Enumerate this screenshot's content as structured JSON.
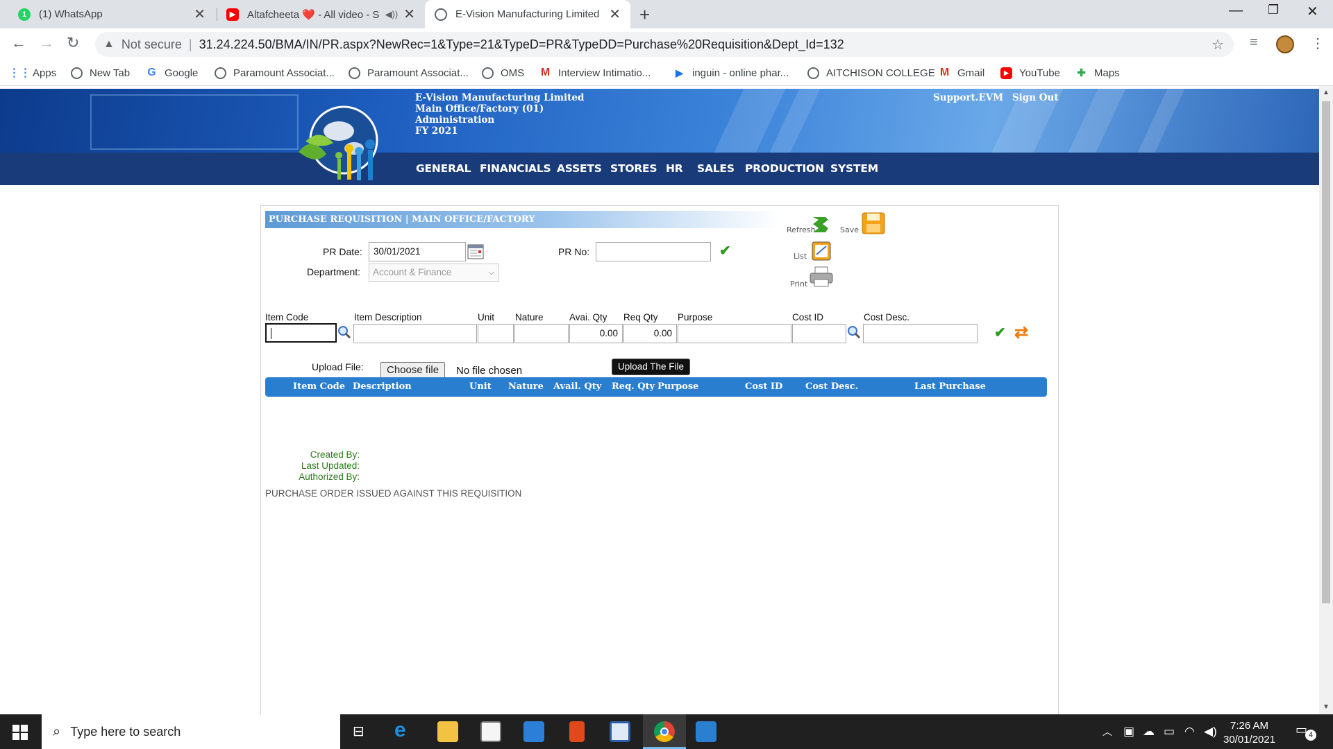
{
  "browser": {
    "tabs": [
      {
        "title": "(1) WhatsApp",
        "icon": "whatsapp-icon",
        "color": "#25d366",
        "badge": "1"
      },
      {
        "title": "Altafcheeta ❤️ - All video - S",
        "icon": "youtube-icon",
        "color": "#ff0000"
      },
      {
        "title": "E-Vision Manufacturing Limited",
        "icon": "globe-icon",
        "color": "#5f6368"
      }
    ],
    "url_status": "Not secure",
    "url": "31.24.224.50/BMA/IN/PR.aspx?NewRec=1&Type=21&TypeD=PR&TypeDD=Purchase%20Requisition&Dept_Id=132",
    "bookmarks": [
      {
        "label": "Apps",
        "icon": "apps-grid-icon"
      },
      {
        "label": "New Tab",
        "icon": "globe-icon"
      },
      {
        "label": "Google",
        "icon": "google-icon"
      },
      {
        "label": "Paramount Associat...",
        "icon": "globe-icon"
      },
      {
        "label": "Paramount Associat...",
        "icon": "globe-icon"
      },
      {
        "label": "OMS",
        "icon": "globe-icon"
      },
      {
        "label": "Interview Intimatio...",
        "icon": "gmail-icon"
      },
      {
        "label": "inguin - online phar...",
        "icon": "play-store-icon"
      },
      {
        "label": "AITCHISON COLLEGE",
        "icon": "globe-icon"
      },
      {
        "label": "Gmail",
        "icon": "gmail-icon"
      },
      {
        "label": "YouTube",
        "icon": "youtube-icon"
      },
      {
        "label": "Maps",
        "icon": "maps-icon"
      }
    ]
  },
  "header": {
    "company": "E-Vision Manufacturing Limited",
    "office": "Main Office/Factory (01)",
    "department": "Administration",
    "fiscal_year": "FY 2021",
    "support_link": "Support.EVM",
    "signout_link": "Sign Out",
    "menu": [
      "GENERAL",
      "FINANCIALS",
      "ASSETS",
      "STORES",
      "HR",
      "SALES",
      "PRODUCTION",
      "SYSTEM"
    ]
  },
  "form": {
    "title": "PURCHASE REQUISITION | MAIN OFFICE/FACTORY",
    "pr_date_label": "PR Date:",
    "pr_date_value": "30/01/2021",
    "pr_no_label": "PR No:",
    "pr_no_value": "",
    "department_label": "Department:",
    "department_value": "Account & Finance",
    "tools": {
      "refresh": "Refresh",
      "save": "Save",
      "list": "List",
      "print": "Print"
    },
    "line_labels": {
      "item_code": "Item Code",
      "item_description": "Item Description",
      "unit": "Unit",
      "nature": "Nature",
      "avail_qty": "Avai. Qty",
      "req_qty": "Req Qty",
      "purpose": "Purpose",
      "cost_id": "Cost ID",
      "cost_desc": "Cost Desc."
    },
    "line_values": {
      "avail_qty": "0.00",
      "req_qty": "0.00"
    },
    "upload_label": "Upload File:",
    "choose_file": "Choose file",
    "no_file": "No file chosen",
    "upload_button": "Upload The File",
    "grid_headers": [
      "Item Code",
      "Description",
      "Unit",
      "Nature",
      "Avail. Qty",
      "Req. Qty",
      "Purpose",
      "Cost ID",
      "Cost Desc.",
      "Last Purchase"
    ],
    "audit": {
      "created_by": "Created By:",
      "last_updated": "Last Updated:",
      "authorized_by": "Authorized By:"
    },
    "po_note": "PURCHASE ORDER ISSUED AGAINST THIS REQUISITION"
  },
  "taskbar": {
    "search_placeholder": "Type here to search",
    "time": "7:26 AM",
    "date": "30/01/2021",
    "notification_count": "4"
  }
}
